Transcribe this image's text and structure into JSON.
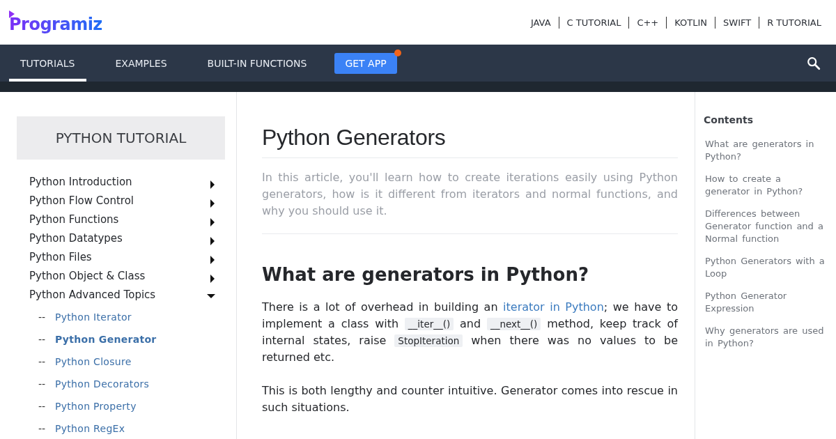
{
  "logo": {
    "text": "Programiz"
  },
  "top_links": [
    "JAVA",
    "C TUTORIAL",
    "C++",
    "KOTLIN",
    "SWIFT",
    "R TUTORIAL"
  ],
  "nav": {
    "tabs": [
      {
        "label": "TUTORIALS",
        "selected": true
      },
      {
        "label": "EXAMPLES",
        "selected": false
      },
      {
        "label": "BUILT-IN FUNCTIONS",
        "selected": false
      }
    ],
    "app_button": {
      "label": "GET APP",
      "notification": true
    }
  },
  "sidebar": {
    "title": "PYTHON TUTORIAL",
    "items": [
      {
        "label": "Python Introduction",
        "expanded": false
      },
      {
        "label": "Python Flow Control",
        "expanded": false
      },
      {
        "label": "Python Functions",
        "expanded": false
      },
      {
        "label": "Python Datatypes",
        "expanded": false
      },
      {
        "label": "Python Files",
        "expanded": false
      },
      {
        "label": "Python Object & Class",
        "expanded": false
      },
      {
        "label": "Python Advanced Topics",
        "expanded": true,
        "children": [
          {
            "prefix": "--",
            "label": "Python Iterator",
            "selected": false
          },
          {
            "prefix": "--",
            "label": "Python Generator",
            "selected": true
          },
          {
            "prefix": "--",
            "label": "Python Closure",
            "selected": false
          },
          {
            "prefix": "--",
            "label": "Python Decorators",
            "selected": false
          },
          {
            "prefix": "--",
            "label": "Python Property",
            "selected": false
          },
          {
            "prefix": "--",
            "label": "Python RegEx",
            "selected": false
          }
        ]
      }
    ]
  },
  "article": {
    "title": "Python Generators",
    "intro": "In this article, you'll learn how to create iterations easily using Python generators, how is it different from iterators and normal functions, and why you should use it.",
    "sections": [
      {
        "heading": "What are generators in Python?",
        "paragraphs": [
          [
            {
              "kind": "text",
              "text": "There is a lot of overhead in building an "
            },
            {
              "kind": "link",
              "text": "iterator in Python"
            },
            {
              "kind": "text",
              "text": "; we have to implement a class with "
            },
            {
              "kind": "code",
              "text": "__iter__()"
            },
            {
              "kind": "text",
              "text": " and "
            },
            {
              "kind": "code",
              "text": "__next__()"
            },
            {
              "kind": "text",
              "text": " method, keep track of internal states, raise "
            },
            {
              "kind": "code",
              "text": "StopIteration"
            },
            {
              "kind": "text",
              "text": " when there was no values to be returned etc."
            }
          ],
          [
            {
              "kind": "text",
              "text": "This is both lengthy and counter intuitive. Generator comes into rescue in such situations."
            }
          ]
        ]
      }
    ]
  },
  "toc": {
    "title": "Contents",
    "items": [
      "What are generators in Python?",
      "How to create a generator in Python?",
      "Differences between Generator function and a Normal function",
      "Python Generators with a Loop",
      "Python Generator Expression",
      "Why generators are used in Python?"
    ]
  }
}
